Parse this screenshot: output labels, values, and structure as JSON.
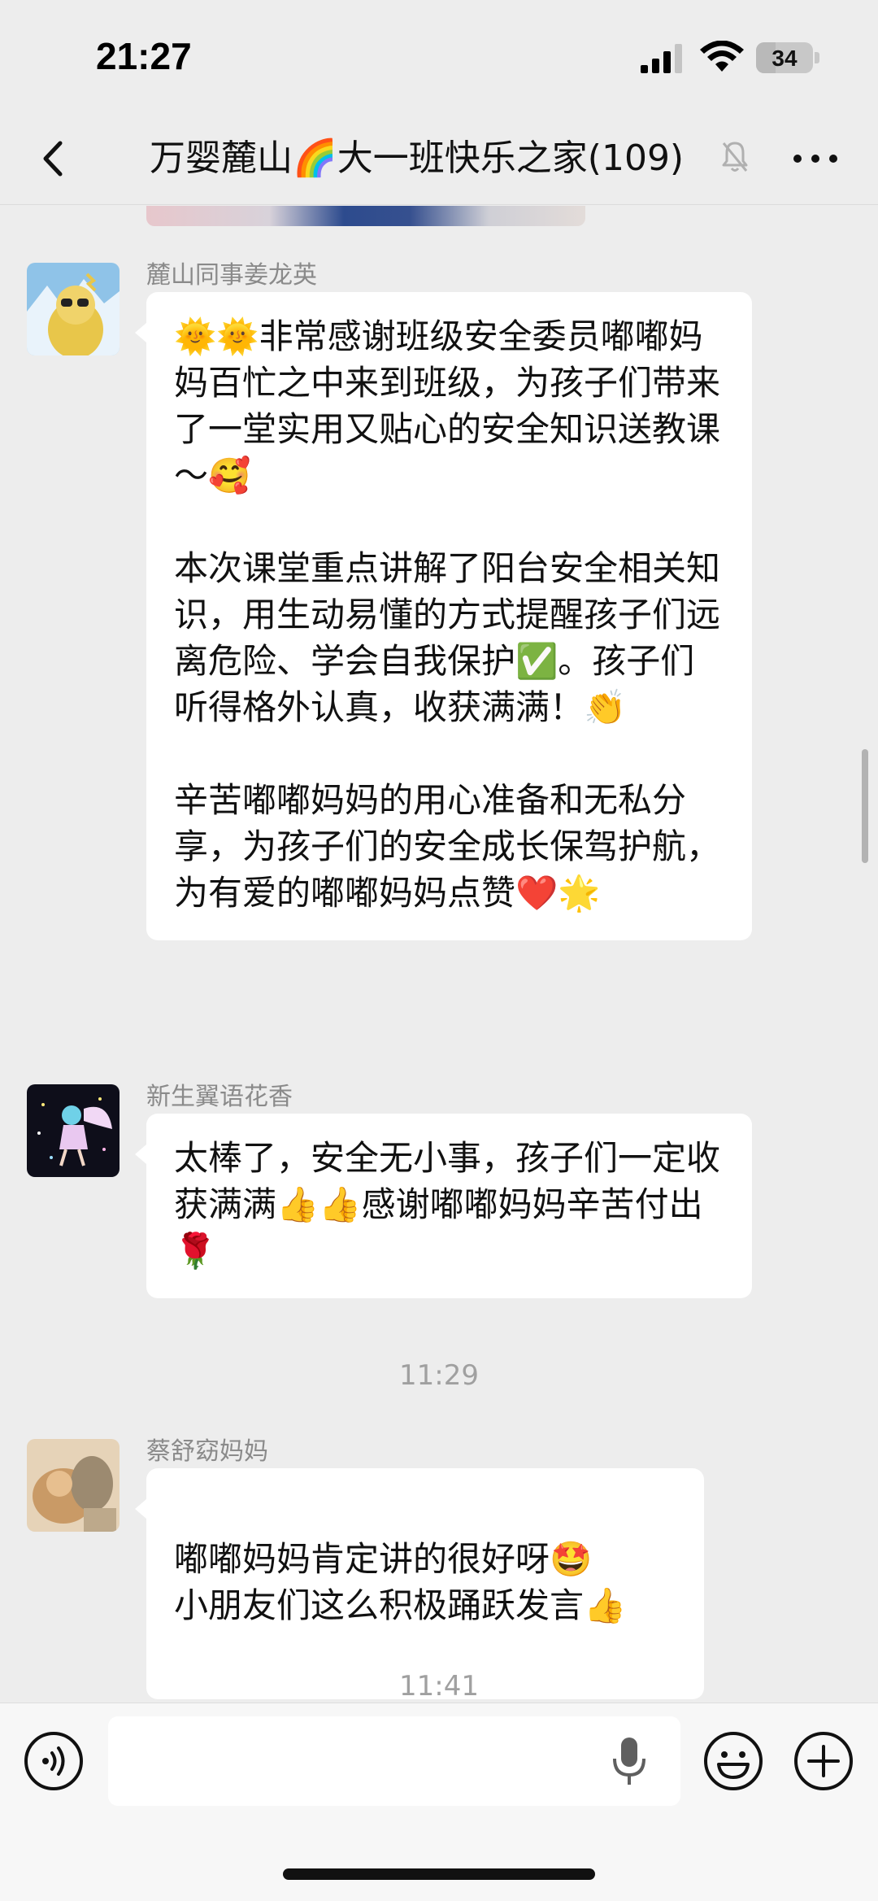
{
  "status_bar": {
    "time": "21:27",
    "battery": "34",
    "battery_level": 0.34
  },
  "nav": {
    "title": "万婴麓山🌈大一班快乐之家(109)"
  },
  "messages": [
    {
      "sender": "麓山同事姜龙英",
      "paragraphs": [
        "🌞🌞非常感谢班级安全委员嘟嘟妈妈百忙之中来到班级，为孩子们带来了一堂实用又贴心的安全知识送教课～🥰",
        "本次课堂重点讲解了阳台安全相关知识，用生动易懂的方式提醒孩子们远离危险、学会自我保护✅。孩子们听得格外认真，收获满满！👏",
        "辛苦嘟嘟妈妈的用心准备和无私分享，为孩子们的安全成长保驾护航，为有爱的嘟嘟妈妈点赞❤️🌟"
      ]
    },
    {
      "sender": "新生翼语花香",
      "paragraphs": [
        "太棒了，安全无小事，孩子们一定收获满满👍👍感谢嘟嘟妈妈辛苦付出🌹"
      ]
    },
    {
      "sender": "蔡舒窈妈妈",
      "paragraphs": [
        "嘟嘟妈妈肯定讲的很好呀🤩\n小朋友们这么积极踊跃发言👍"
      ]
    }
  ],
  "timestamps": [
    "11:29",
    "11:41"
  ],
  "input": {
    "value": ""
  }
}
